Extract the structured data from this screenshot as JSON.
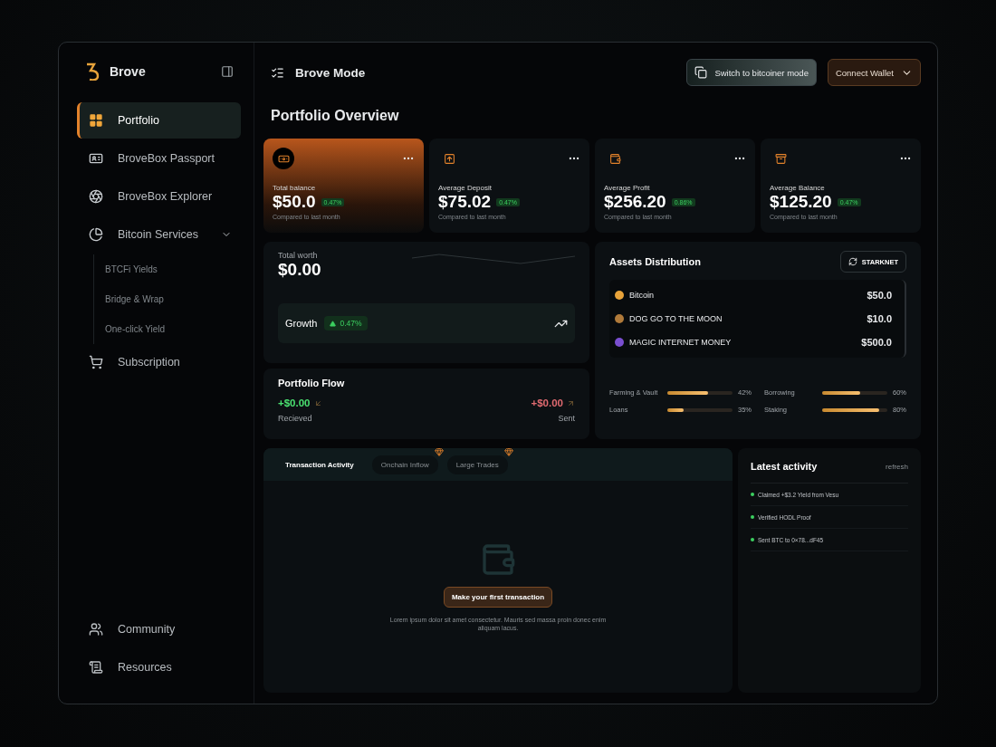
{
  "sidebar": {
    "brand": "Brove",
    "items": [
      {
        "label": "Portfolio",
        "selected": true
      },
      {
        "label": "BroveBox Passport",
        "selected": false
      },
      {
        "label": "BroveBox Explorer",
        "selected": false
      },
      {
        "label": "Bitcoin Services",
        "selected": false,
        "expanded": true,
        "children": [
          {
            "label": "BTCFi Yields"
          },
          {
            "label": "Bridge & Wrap"
          },
          {
            "label": "One-click Yield"
          }
        ]
      },
      {
        "label": "Subscription",
        "selected": false
      }
    ],
    "footer_items": [
      {
        "label": "Community"
      },
      {
        "label": "Resources"
      }
    ]
  },
  "header": {
    "title": "Brove Mode",
    "switch_button": "Switch to bitcoiner mode",
    "connect_button": "Connect Wallet"
  },
  "page_title": "Portfolio Overview",
  "stat_cards": [
    {
      "label": "Total balance",
      "value": "$50.0",
      "badge": "0.47%",
      "note": "Compared to last month",
      "highlighted": true
    },
    {
      "label": "Average Deposit",
      "value": "$75.02",
      "badge": "0.47%",
      "note": "Compared to last month",
      "highlighted": false
    },
    {
      "label": "Average Profit",
      "value": "$256.20",
      "badge": "0.86%",
      "note": "Compared to last month",
      "highlighted": false
    },
    {
      "label": "Average Balance",
      "value": "$125.20",
      "badge": "0.47%",
      "note": "Compared to last month",
      "highlighted": false
    }
  ],
  "total_worth": {
    "label": "Total worth",
    "value": "$0.00",
    "growth_label": "Growth",
    "growth_badge": "0.47%"
  },
  "portfolio_flow": {
    "title": "Portfolio Flow",
    "received_value": "+$0.00",
    "received_label": "Recieved",
    "sent_value": "+$0.00",
    "sent_label": "Sent"
  },
  "assets": {
    "title": "Assets Distribution",
    "network_button": "STARKNET",
    "rows": [
      {
        "name": "Bitcoin",
        "value": "$50.0",
        "color": "#e8a33a"
      },
      {
        "name": "DOG GO TO THE MOON",
        "value": "$10.0",
        "color": "#b07a3a"
      },
      {
        "name": "MAGIC INTERNET MONEY",
        "value": "$500.0",
        "color": "#7a4fd0"
      }
    ],
    "meters": [
      {
        "label": "Farming & Vault",
        "level": 0.62,
        "reading": "42%"
      },
      {
        "label": "Borrowing",
        "level": 0.58,
        "reading": "60%"
      },
      {
        "label": "Loans",
        "level": 0.25,
        "reading": "35%"
      },
      {
        "label": "Staking",
        "level": 0.88,
        "reading": "80%"
      }
    ]
  },
  "activity": {
    "tabs": [
      {
        "label": "Transaction Activity",
        "selected": true,
        "premium": false
      },
      {
        "label": "Onchain Inflow",
        "selected": false,
        "premium": true
      },
      {
        "label": "Large Trades",
        "selected": false,
        "premium": true
      }
    ],
    "empty_button": "Make your first transaction",
    "empty_text": "Lorem ipsum dolor sit amet consectetur. Mauris sed massa proin donec enim aliquam lacus."
  },
  "latest": {
    "title": "Latest activity",
    "refresh": "refresh",
    "items": [
      {
        "text": "Claimed +$3.2 Yield from Vesu"
      },
      {
        "text": "Verified HODL Proof"
      },
      {
        "text": "Sent BTC to 0×78...dF45"
      }
    ]
  }
}
